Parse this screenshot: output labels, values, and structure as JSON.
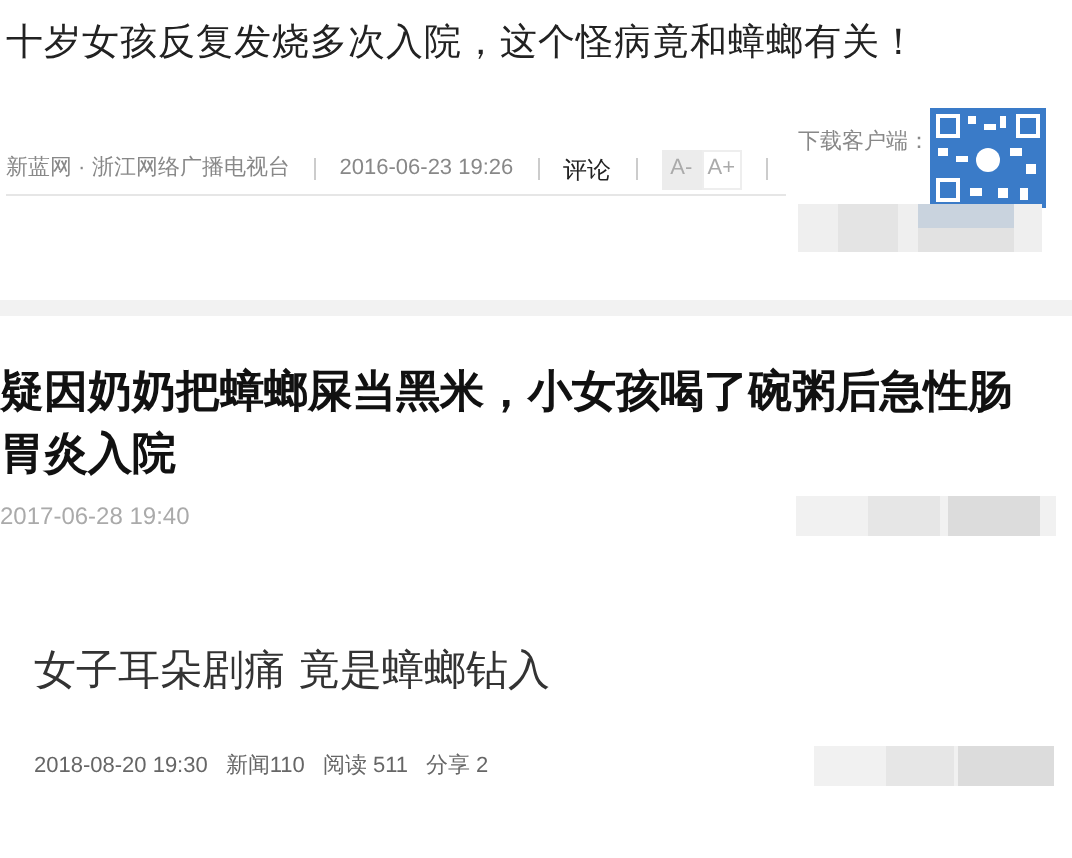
{
  "article_1": {
    "title": "十岁女孩反复发烧多次入院，这个怪病竟和蟑螂有关！",
    "source": "新蓝网 · 浙江网络广播电视台",
    "datetime": "2016-06-23 19:26",
    "comment_link": "评论",
    "font_buttons": [
      {
        "label": "A-",
        "selected": true
      },
      {
        "label": "A+",
        "selected": false
      }
    ],
    "download_label": "下载客户端："
  },
  "article_2": {
    "title": "疑因奶奶把蟑螂屎当黑米，小女孩喝了碗粥后急性肠胃炎入院",
    "datetime": "2017-06-28 19:40"
  },
  "article_3": {
    "title": "女子耳朵剧痛 竟是蟑螂钻入",
    "datetime": "2018-08-20 19:30",
    "stats": [
      "新闻110",
      "阅读 511",
      "分享 2"
    ]
  }
}
